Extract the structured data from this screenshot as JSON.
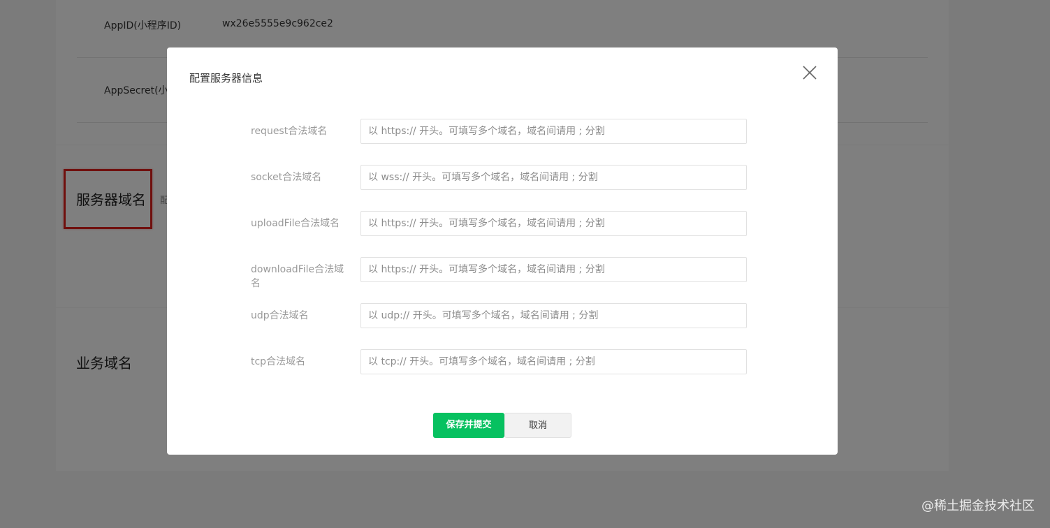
{
  "background": {
    "app_id_label": "AppID(小程序ID)",
    "app_id_value": "wx26e5555e9c962ce2",
    "app_secret_label": "AppSecret(小",
    "server_domain_title": "服务器域名",
    "server_domain_hint": "配",
    "business_domain_title": "业务域名"
  },
  "dialog": {
    "title": "配置服务器信息",
    "fields": [
      {
        "label": "request合法域名",
        "placeholder": "以 https:// 开头。可填写多个域名，域名间请用 ; 分割"
      },
      {
        "label": "socket合法域名",
        "placeholder": "以 wss:// 开头。可填写多个域名，域名间请用 ; 分割"
      },
      {
        "label": "uploadFile合法域名",
        "placeholder": "以 https:// 开头。可填写多个域名，域名间请用 ; 分割"
      },
      {
        "label": "downloadFile合法域名",
        "placeholder": "以 https:// 开头。可填写多个域名，域名间请用 ; 分割"
      },
      {
        "label": "udp合法域名",
        "placeholder": "以 udp:// 开头。可填写多个域名，域名间请用 ; 分割"
      },
      {
        "label": "tcp合法域名",
        "placeholder": "以 tcp:// 开头。可填写多个域名，域名间请用 ; 分割"
      }
    ],
    "submit_label": "保存并提交",
    "cancel_label": "取消"
  },
  "watermark": "@稀土掘金技术社区",
  "colors": {
    "primary": "#07c160",
    "highlight": "#e0201d",
    "mask": "rgba(0,0,0,0.5)"
  },
  "icons": {
    "close": "close-icon"
  }
}
